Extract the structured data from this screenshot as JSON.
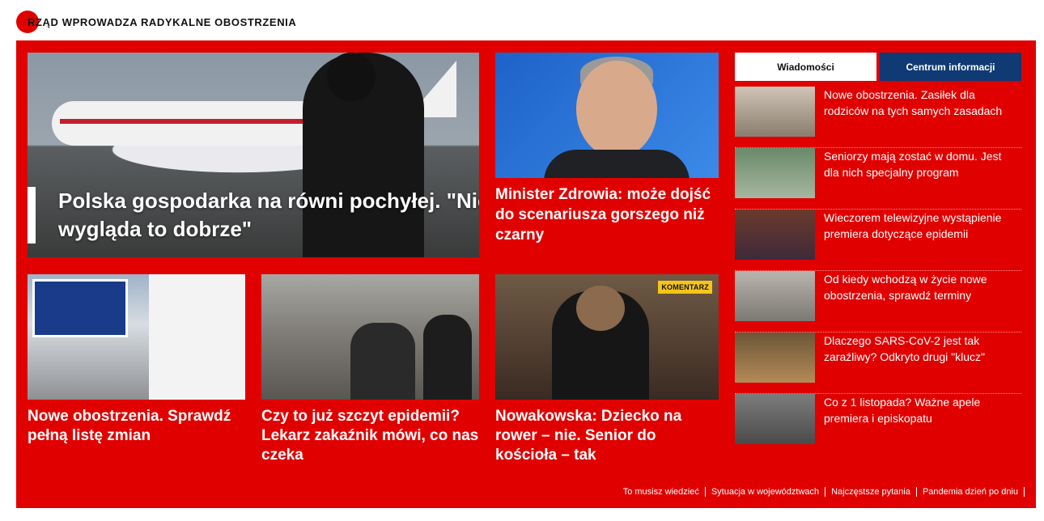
{
  "header": {
    "title": "RZĄD WPROWADZA RADYKALNE OBOSTRZENIA"
  },
  "colors": {
    "accent": "#e10000",
    "navy": "#0f3a73",
    "badge": "#f5c518"
  },
  "hero": {
    "title": "Polska gospodarka na równi pochyłej. \"Nie wygląda to dobrze\""
  },
  "feature": {
    "title": "Minister Zdrowia: może dojść do scenariusza gorszego niż czarny"
  },
  "cards": [
    {
      "title": "Nowe obostrzenia. Sprawdź pełną listę zmian"
    },
    {
      "title": "Czy to już szczyt epidemii? Lekarz zakaźnik mówi, co nas czeka"
    },
    {
      "title": "Nowakowska: Dziecko na rower – nie. Senior do kościoła – tak",
      "badge": "KOMENTARZ"
    }
  ],
  "tabs": [
    "Wiadomości",
    "Centrum informacji"
  ],
  "sidebar": [
    {
      "title": "Nowe obostrzenia. Zasiłek dla rodziców na tych samych zasadach"
    },
    {
      "title": "Seniorzy mają zostać w domu. Jest dla nich specjalny program"
    },
    {
      "title": "Wieczorem telewizyjne wystąpienie premiera dotyczące epidemii"
    },
    {
      "title": "Od kiedy wchodzą w życie nowe obostrzenia, sprawdź terminy"
    },
    {
      "title": "Dlaczego SARS-CoV-2 jest tak zaraźliwy? Odkryto drugi \"klucz\""
    },
    {
      "title": "Co z 1 listopada? Ważne apele premiera i episkopatu"
    }
  ],
  "footer_links": [
    "To musisz wiedzieć",
    "Sytuacja w województwach",
    "Najczęstsze pytania",
    "Pandemia dzień po dniu"
  ]
}
